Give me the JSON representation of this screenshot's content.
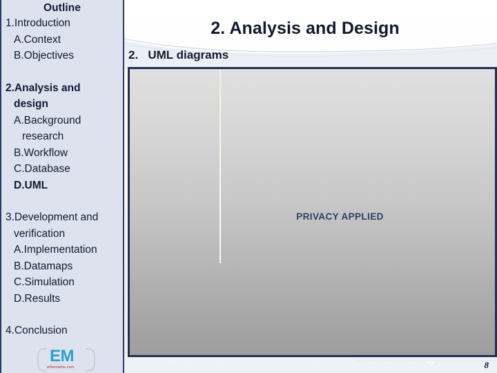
{
  "slide": {
    "title": "2. Analysis and Design",
    "subtitle": "2.   UML diagrams",
    "page_number": "8",
    "accent_color": "#252d52",
    "sidebar_bg": "#dce3ef",
    "text_color": "#101a33"
  },
  "sidebar": {
    "heading": "Outline",
    "items": [
      {
        "text": "1.Introduction",
        "level": 0,
        "bold": false,
        "gap_before": false
      },
      {
        "text": "A.Context",
        "level": 1,
        "bold": false,
        "gap_before": false
      },
      {
        "text": "B.Objectives",
        "level": 1,
        "bold": false,
        "gap_before": false
      },
      {
        "text": "2.Analysis and",
        "level": 0,
        "bold": true,
        "gap_before": true
      },
      {
        "text": "design",
        "level": 1,
        "bold": true,
        "gap_before": false
      },
      {
        "text": "A.Background",
        "level": 1,
        "bold": false,
        "gap_before": false
      },
      {
        "text": "research",
        "level": 2,
        "bold": false,
        "gap_before": false
      },
      {
        "text": "B.Workflow",
        "level": 1,
        "bold": false,
        "gap_before": false
      },
      {
        "text": "C.Database",
        "level": 1,
        "bold": false,
        "gap_before": false
      },
      {
        "text": "D.UML",
        "level": 1,
        "bold": true,
        "gap_before": false
      },
      {
        "text": "3.Development and",
        "level": 0,
        "bold": false,
        "gap_before": true
      },
      {
        "text": "verification",
        "level": 1,
        "bold": false,
        "gap_before": false
      },
      {
        "text": "A.Implementation",
        "level": 1,
        "bold": false,
        "gap_before": false
      },
      {
        "text": "B.Datamaps",
        "level": 1,
        "bold": false,
        "gap_before": false
      },
      {
        "text": "C.Simulation",
        "level": 1,
        "bold": false,
        "gap_before": false
      },
      {
        "text": "D.Results",
        "level": 1,
        "bold": false,
        "gap_before": false
      },
      {
        "text": "4.Conclusion",
        "level": 0,
        "bold": false,
        "gap_before": true
      }
    ]
  },
  "logo": {
    "mark": "EM",
    "url": "elitemaths.com",
    "mark_color": "#2f9fd0",
    "url_color": "#b0281f"
  },
  "content": {
    "privacy_label": "PRIVACY APPLIED",
    "privacy_color": "#29415e"
  }
}
